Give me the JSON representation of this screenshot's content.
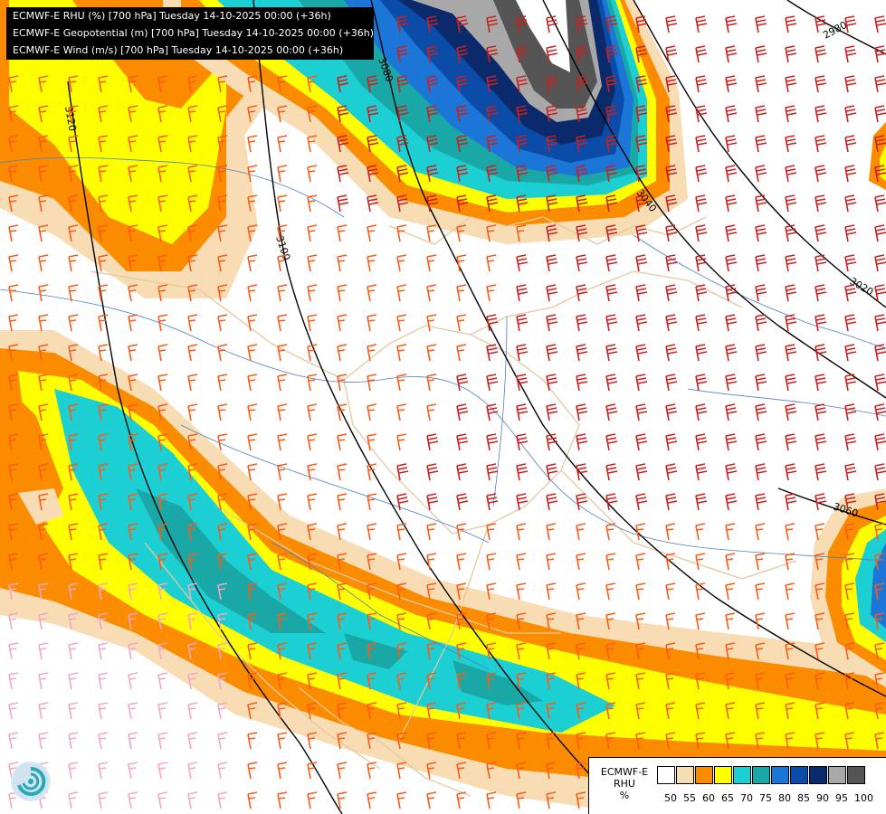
{
  "header": {
    "lines": [
      "ECMWF-E RHU (%) [700 hPa] Tuesday 14-10-2025 00:00 (+36h)",
      "ECMWF-E Geopotential (m) [700 hPa] Tuesday 14-10-2025 00:00 (+36h)",
      "ECMWF-E Wind (m/s) [700 hPa] Tuesday 14-10-2025 00:00 (+36h)"
    ]
  },
  "legend": {
    "title_line1": "ECMWF-E",
    "title_line2": "RHU",
    "unit": "%",
    "labels": [
      "50",
      "55",
      "60",
      "65",
      "70",
      "75",
      "80",
      "85",
      "90",
      "95",
      "100"
    ],
    "colors": [
      "#ffffff",
      "#f7dcb4",
      "#fb8c00",
      "#ffff00",
      "#1ccfd2",
      "#19a8a6",
      "#1b76d8",
      "#0a4ca8",
      "#0a2a6c",
      "#a8a8a8",
      "#555555"
    ]
  },
  "contours": [
    {
      "label": "3120"
    },
    {
      "label": "3100"
    },
    {
      "label": "3080"
    },
    {
      "label": "3060"
    },
    {
      "label": "3040"
    },
    {
      "label": "3020"
    },
    {
      "label": "2980"
    },
    {
      "label": "3060"
    }
  ],
  "colors": {
    "wind_red": "#cc1f1f",
    "wind_orange": "#ff5a14",
    "wind_pink": "#f4a6c3",
    "borders": "#e3c9a0",
    "rivers": "#4f7fc4"
  },
  "icons": {
    "logo": "ecmwf-swirl-logo-icon"
  }
}
